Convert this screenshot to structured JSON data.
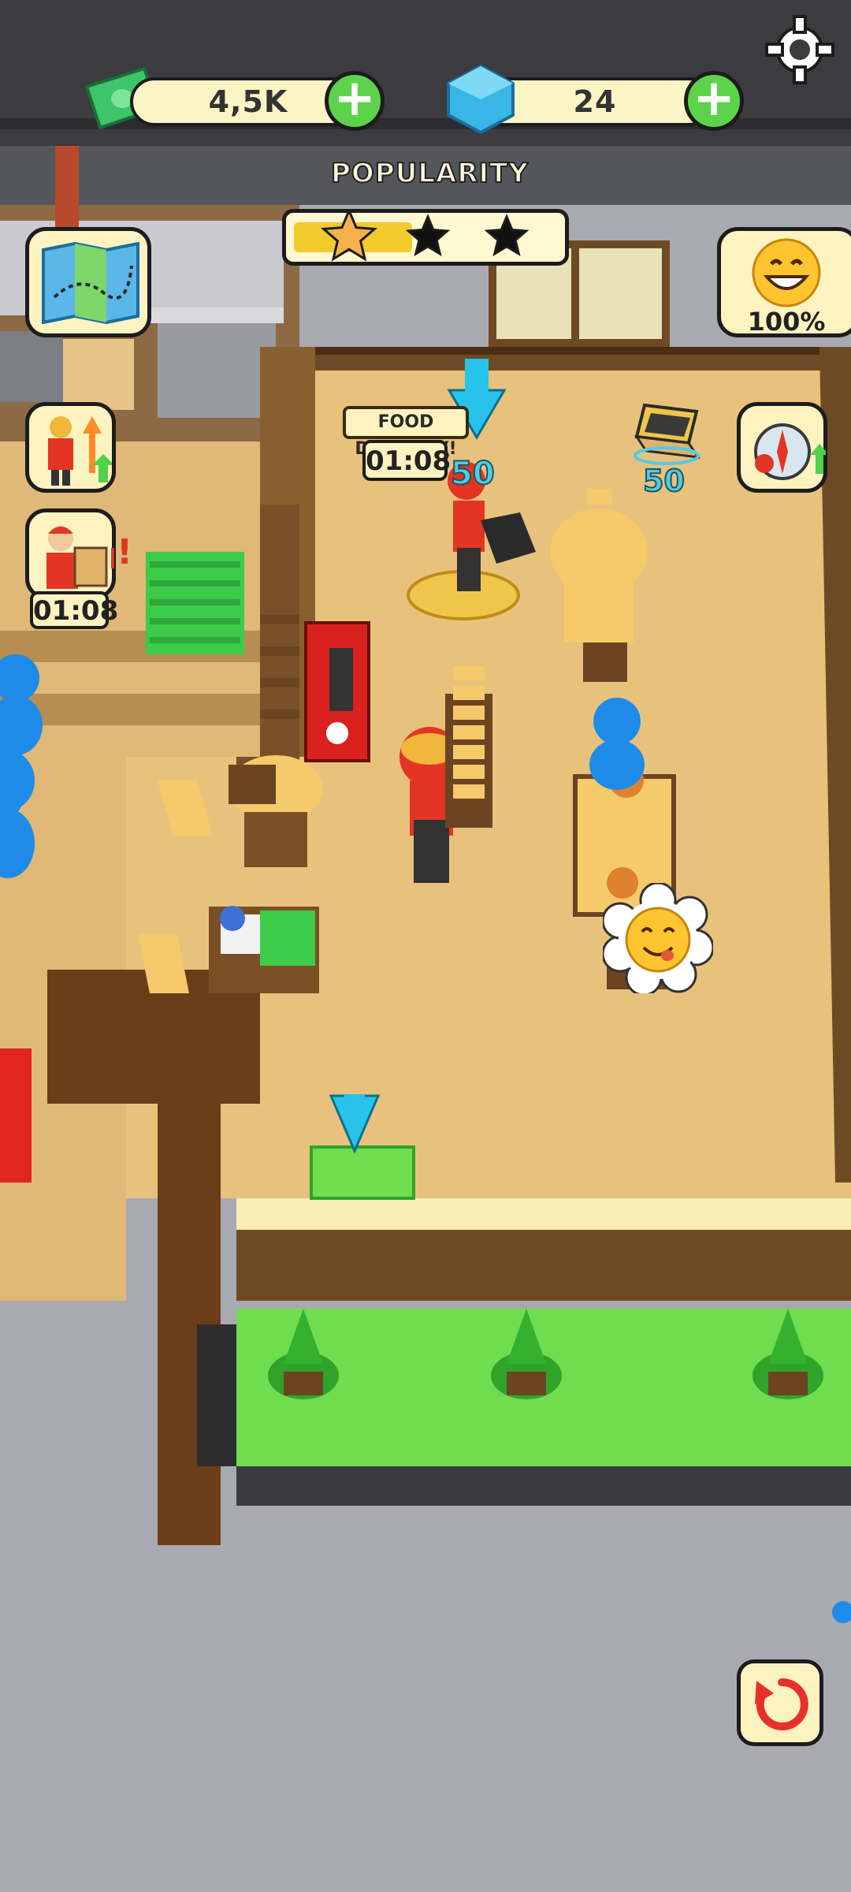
{
  "hud": {
    "cash": "4,5K",
    "gems": "24",
    "add_cash_label": "+",
    "add_gems_label": "+",
    "settings_icon": "gear-icon"
  },
  "popularity": {
    "title": "POPULARITY",
    "stars_filled": 1,
    "stars_total": 3,
    "progress": 0.45
  },
  "satisfaction": {
    "value": "100%",
    "icon": "grin-face-icon"
  },
  "left_panel": {
    "map_icon": "map-icon",
    "upgrade_staff_icon": "staff-upgrade-icon",
    "delivery_icon": "delivery-worker-icon",
    "delivery_timer": "01:08"
  },
  "right_panel": {
    "compass_icon": "compass-upgrade-icon"
  },
  "food_delivery": {
    "label": "FOOD DELIVERY!",
    "timer": "01:08",
    "cost": "50"
  },
  "laptop_cost": "50",
  "bottom_button_icon": "rotate-refresh-icon",
  "colors": {
    "cash_green": "#3ec46b",
    "gem_blue": "#38b6e6",
    "star_gold": "#f6b24a",
    "accent_green": "#5cd34a"
  }
}
